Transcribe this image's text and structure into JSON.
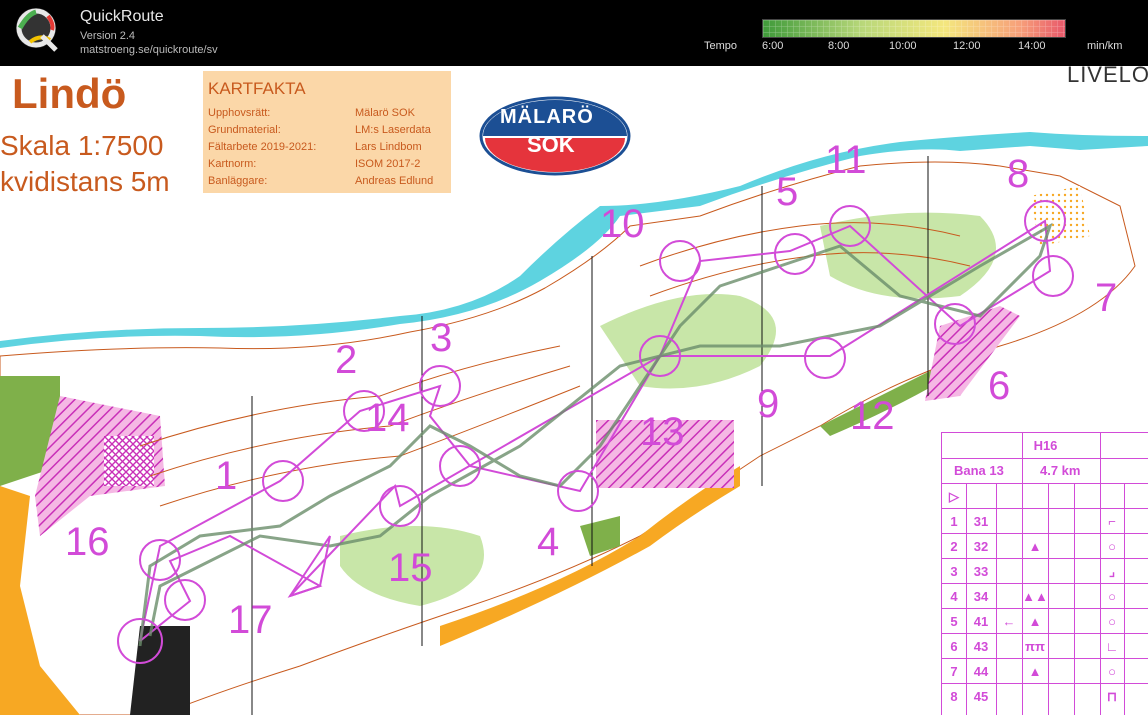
{
  "app": {
    "title": "QuickRoute",
    "version": "Version 2.4",
    "url": "matstroeng.se/quickroute/sv"
  },
  "tempo": {
    "label": "Tempo",
    "ticks": [
      "6:00",
      "8:00",
      "10:00",
      "12:00",
      "14:00"
    ],
    "unit": "min/km"
  },
  "map": {
    "title": "Lindö",
    "scale": "Skala 1:7500",
    "contour": "kvidistans 5m",
    "club_logo_top": "MÄLARÖ",
    "club_logo_bottom": "SOK",
    "corner_text": "LIVELO"
  },
  "kartfakta": {
    "heading": "KARTFAKTA",
    "rows": [
      {
        "key": "Upphovsrätt:",
        "value": "Mälarö SOK"
      },
      {
        "key": "Grundmaterial:",
        "value": "LM:s Laserdata"
      },
      {
        "key": "Fältarbete 2019-2021:",
        "value": "Lars Lindbom"
      },
      {
        "key": "Kartnorm:",
        "value": "ISOM 2017-2"
      },
      {
        "key": "Banläggare:",
        "value": "Andreas Edlund"
      }
    ]
  },
  "controls": [
    "1",
    "2",
    "3",
    "4",
    "5",
    "6",
    "7",
    "8",
    "9",
    "10",
    "11",
    "12",
    "13",
    "14",
    "15",
    "16",
    "17"
  ],
  "descriptions": {
    "class": "H16",
    "course": "Bana 13",
    "length": "4.7 km",
    "start_symbol": "▷",
    "rows": [
      {
        "n": "1",
        "code": "31",
        "dir": "",
        "feature": "",
        "detail": "⌐"
      },
      {
        "n": "2",
        "code": "32",
        "dir": "",
        "feature": "▲",
        "detail": "○"
      },
      {
        "n": "3",
        "code": "33",
        "dir": "",
        "feature": "",
        "detail": "⌟"
      },
      {
        "n": "4",
        "code": "34",
        "dir": "",
        "feature": "▲▲",
        "detail": "○"
      },
      {
        "n": "5",
        "code": "41",
        "dir": "←",
        "feature": "▲",
        "detail": "○"
      },
      {
        "n": "6",
        "code": "43",
        "dir": "",
        "feature": "ππ",
        "detail": "∟"
      },
      {
        "n": "7",
        "code": "44",
        "dir": "",
        "feature": "▲",
        "detail": "○"
      },
      {
        "n": "8",
        "code": "45",
        "dir": "",
        "feature": "",
        "detail": "⊓"
      }
    ]
  },
  "colors": {
    "course": "#d24bd8",
    "water": "#5ed3e0",
    "road": "#f7a823",
    "green": "#c8e6a8",
    "dark_green": "#7fb04a",
    "brown": "#c85a1e"
  }
}
